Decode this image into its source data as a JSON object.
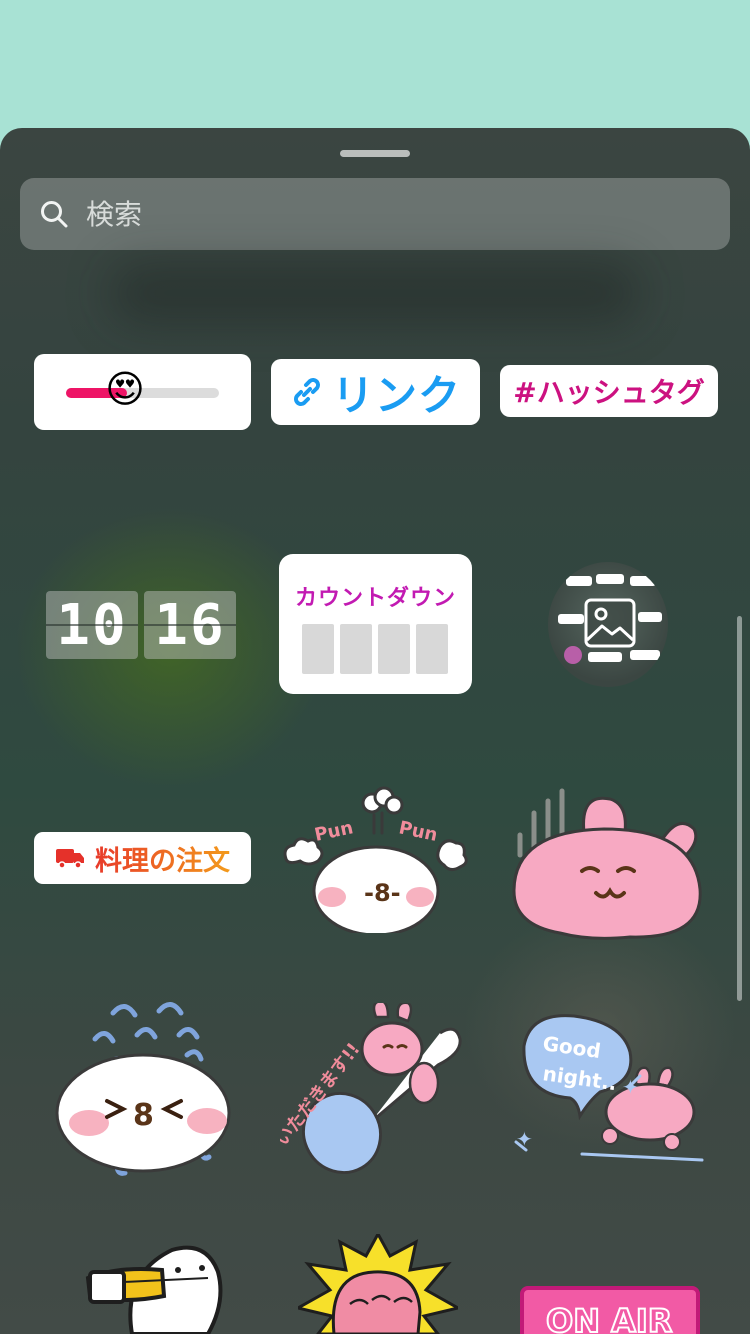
{
  "search": {
    "placeholder": "検索"
  },
  "stickers": {
    "slider": {
      "emoji": "😍",
      "level": 0.4
    },
    "link": {
      "label": "リンク"
    },
    "hashtag": {
      "label": "#ハッシュタグ"
    },
    "clock": {
      "hours": "10",
      "minutes": "16"
    },
    "countdown": {
      "label": "カウントダウン"
    },
    "food": {
      "label": "料理の注文"
    },
    "pun": {
      "left": "Pun",
      "right": "Pun"
    },
    "itadakimasu": {
      "text": "いただきます!!"
    },
    "goodnight": {
      "line1": "Good",
      "line2": "night.."
    },
    "onair": {
      "text": "ON AIR"
    }
  },
  "colors": {
    "background_top": "#a8e2d4",
    "link_blue": "#1a9cf2",
    "hashtag_magenta": "#cc1180",
    "countdown_purple": "#c21ab2",
    "slider_pink": "#ee1466",
    "food_orange": "#f39a1b"
  },
  "icons": [
    "search-icon",
    "link-icon",
    "truck-icon",
    "photo-icon"
  ]
}
